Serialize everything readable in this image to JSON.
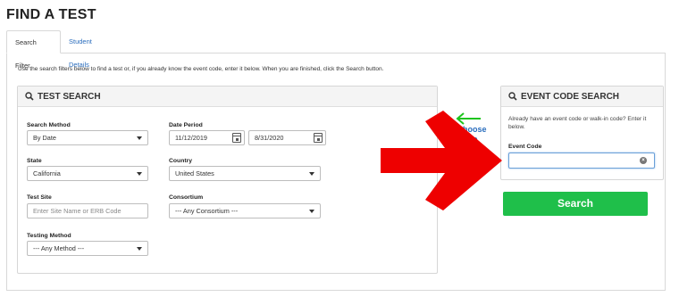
{
  "page": {
    "title": "FIND A TEST"
  },
  "tabs": [
    {
      "label": "Search Filter",
      "active": true
    },
    {
      "label": "Student Details",
      "active": false
    }
  ],
  "intro_text": "Use the search filters below to find a test or, if you already know the event code, enter it below. When you are finished, click the Search button.",
  "test_search": {
    "title": "TEST SEARCH",
    "search_method": {
      "label": "Search Method",
      "value": "By Date"
    },
    "date_period": {
      "label": "Date Period",
      "start": "11/12/2019",
      "end": "8/31/2020"
    },
    "state": {
      "label": "State",
      "value": "California"
    },
    "country": {
      "label": "Country",
      "value": "United States"
    },
    "test_site": {
      "label": "Test Site",
      "placeholder": "Enter Site Name or ERB Code"
    },
    "consortium": {
      "label": "Consortium",
      "value": "--- Any Consortium ---"
    },
    "testing_method": {
      "label": "Testing Method",
      "value": "--- Any Method ---"
    }
  },
  "event_code_search": {
    "title": "EVENT CODE SEARCH",
    "description": "Already have an event code or walk-in code? Enter it below.",
    "field_label": "Event Code",
    "value": ""
  },
  "overlay": {
    "choose_line1": "Choose",
    "choose_line2": "me"
  },
  "search_button": {
    "label": "Search"
  },
  "colors": {
    "accent_green": "#1fbf4a",
    "link_blue": "#2a6dbd",
    "arrow_red": "#ee0000",
    "arrow_green": "#1ec41e"
  }
}
